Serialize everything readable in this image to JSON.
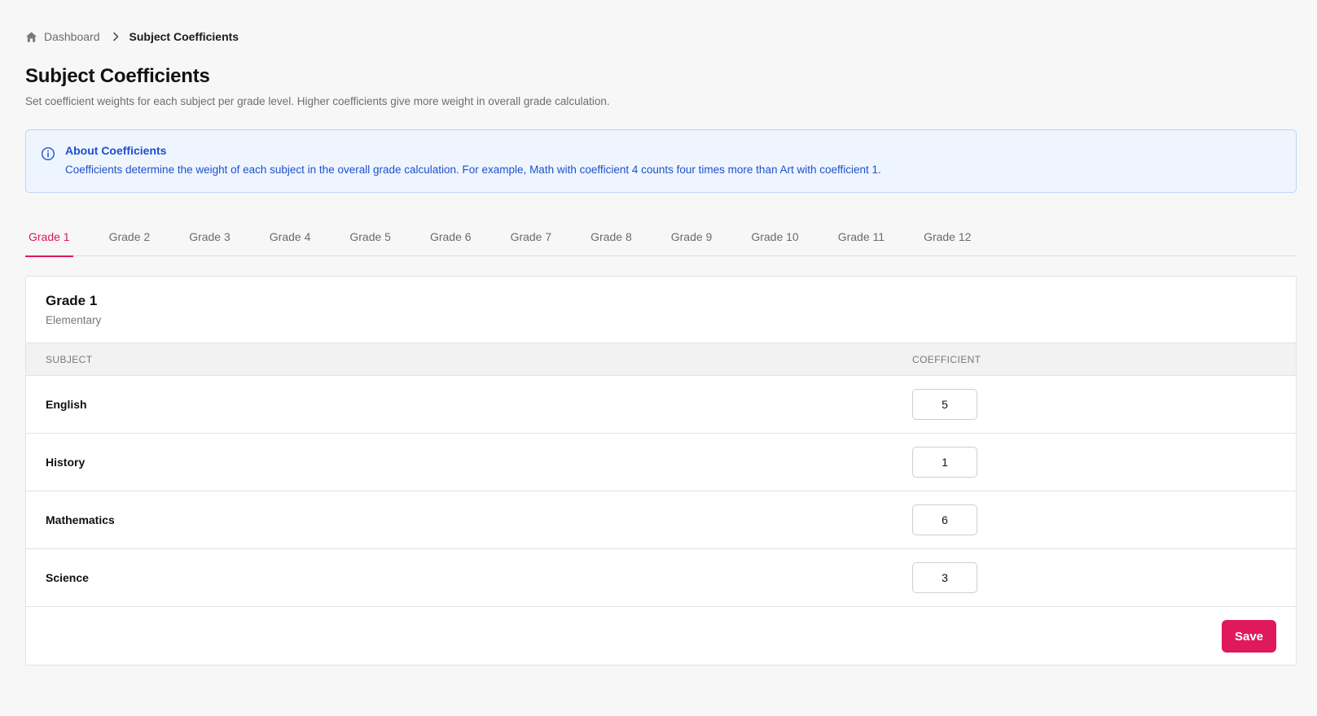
{
  "breadcrumb": {
    "home_label": "Dashboard",
    "home_icon": "home-icon",
    "separator_icon": "chevron-right-icon",
    "current": "Subject Coefficients"
  },
  "header": {
    "title": "Subject Coefficients",
    "subtitle": "Set coefficient weights for each subject per grade level. Higher coefficients give more weight in overall grade calculation."
  },
  "info": {
    "icon": "info-icon",
    "title": "About Coefficients",
    "text": "Coefficients determine the weight of each subject in the overall grade calculation. For example, Math with coefficient 4 counts four times more than Art with coefficient 1."
  },
  "tabs": [
    {
      "label": "Grade 1",
      "active": true
    },
    {
      "label": "Grade 2",
      "active": false
    },
    {
      "label": "Grade 3",
      "active": false
    },
    {
      "label": "Grade 4",
      "active": false
    },
    {
      "label": "Grade 5",
      "active": false
    },
    {
      "label": "Grade 6",
      "active": false
    },
    {
      "label": "Grade 7",
      "active": false
    },
    {
      "label": "Grade 8",
      "active": false
    },
    {
      "label": "Grade 9",
      "active": false
    },
    {
      "label": "Grade 10",
      "active": false
    },
    {
      "label": "Grade 11",
      "active": false
    },
    {
      "label": "Grade 12",
      "active": false
    }
  ],
  "card": {
    "title": "Grade 1",
    "subtitle": "Elementary",
    "columns": {
      "subject": "SUBJECT",
      "coefficient": "COEFFICIENT"
    },
    "rows": [
      {
        "subject": "English",
        "coefficient": "5"
      },
      {
        "subject": "History",
        "coefficient": "1"
      },
      {
        "subject": "Mathematics",
        "coefficient": "6"
      },
      {
        "subject": "Science",
        "coefficient": "3"
      }
    ],
    "save_label": "Save"
  },
  "colors": {
    "accent": "#e0185c",
    "info_bg": "#eef5ff",
    "info_text": "#1f4fcf"
  }
}
